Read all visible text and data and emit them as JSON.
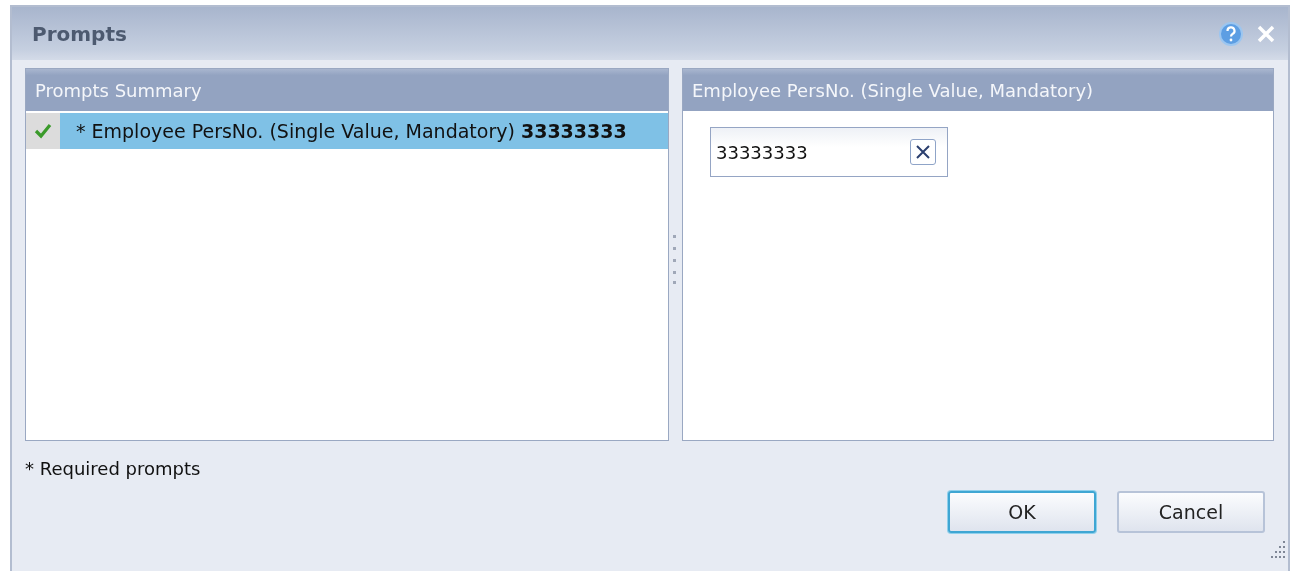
{
  "window": {
    "title": "Prompts"
  },
  "summary_panel": {
    "title": "Prompts Summary",
    "items": [
      {
        "label": "* Employee PersNo. (Single Value, Mandatory) **33333333**",
        "checked": true,
        "selected": true
      }
    ]
  },
  "detail_panel": {
    "title": "Employee PersNo. (Single Value, Mandatory)",
    "field": {
      "value": "33333333"
    }
  },
  "note": "* Required prompts",
  "buttons": [
    {
      "label": "OK",
      "focused": true
    },
    {
      "label": "Cancel",
      "focused": false
    }
  ]
}
